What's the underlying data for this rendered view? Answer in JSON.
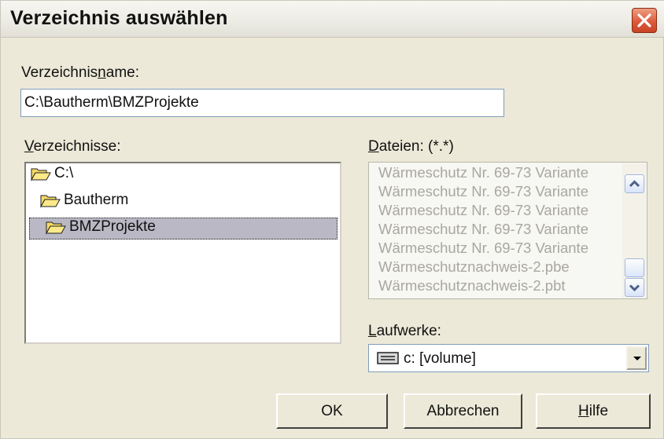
{
  "window": {
    "title": "Verzeichnis auswählen"
  },
  "dirname": {
    "label_pre": "Verzeichnis",
    "label_u": "n",
    "label_post": "ame:",
    "value": "C:\\Bautherm\\BMZProjekte"
  },
  "dirs": {
    "label_u": "V",
    "label_post": "erzeichnisse:",
    "items": [
      "C:\\",
      "Bautherm",
      "BMZProjekte"
    ],
    "selected": "BMZProjekte"
  },
  "files": {
    "label_u": "D",
    "label_post": "ateien: (*.*)",
    "items": [
      "Wärmeschutz Nr. 69-73  Variante",
      "Wärmeschutz Nr. 69-73  Variante",
      "Wärmeschutz Nr. 69-73  Variante",
      "Wärmeschutz Nr. 69-73  Variante",
      "Wärmeschutz Nr. 69-73  Variante",
      "Wärmeschutznachweis-2.pbe",
      "Wärmeschutznachweis-2.pbt"
    ]
  },
  "drives": {
    "label_u": "L",
    "label_post": "aufwerke:",
    "value": "c: [volume]"
  },
  "buttons": {
    "ok": "OK",
    "cancel": "Abbrechen",
    "help_u": "H",
    "help_post": "ilfe"
  },
  "icons": {
    "close": "close-icon",
    "folder": "open-folder-icon",
    "drive": "drive-icon",
    "scroll_up": "arrow-up-icon",
    "scroll_down": "arrow-down-icon",
    "dropdown": "dropdown-arrow-icon"
  },
  "colors": {
    "dialog_bg": "#ece9d8",
    "close_red": "#de5a3b",
    "selection": "#b9b8c4",
    "disabled_text": "#a9a7a0"
  }
}
